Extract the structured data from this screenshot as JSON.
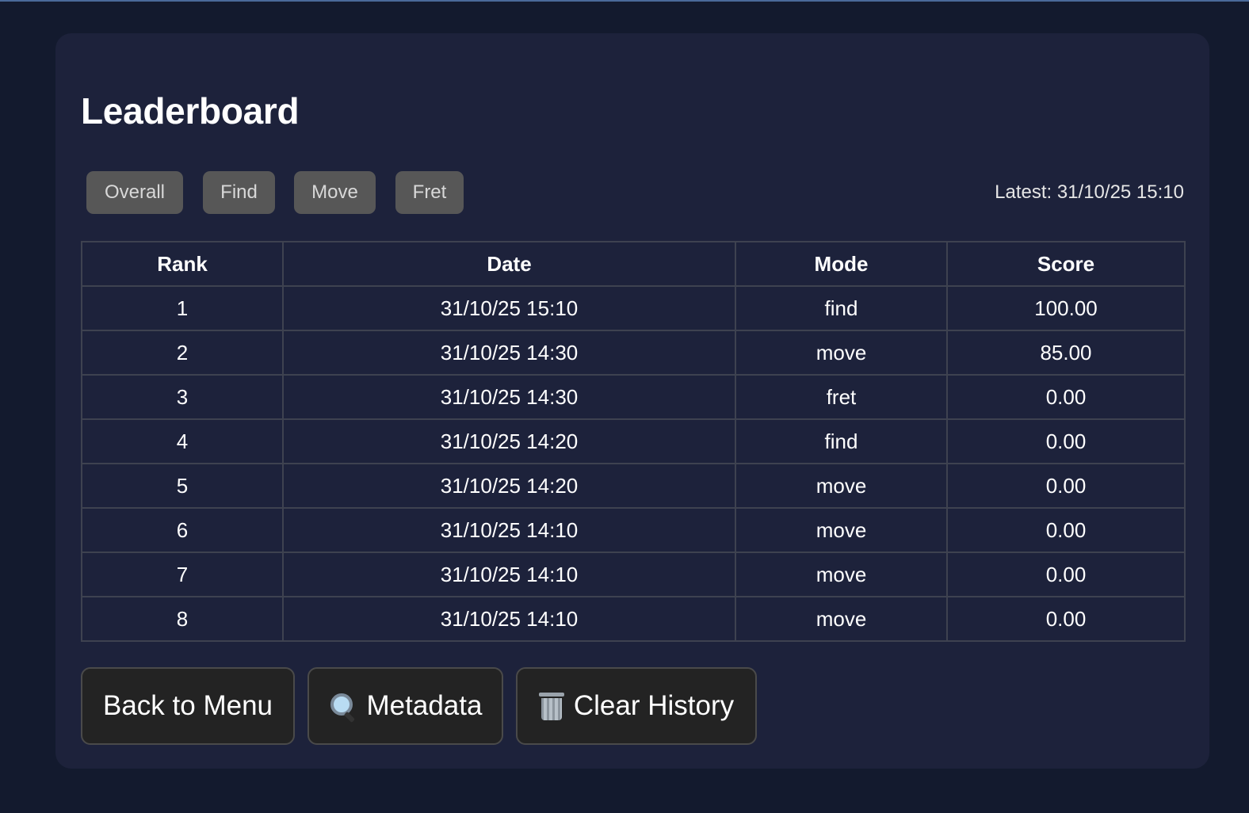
{
  "title": "Leaderboard",
  "filters": {
    "items": [
      {
        "label": "Overall"
      },
      {
        "label": "Find"
      },
      {
        "label": "Move"
      },
      {
        "label": "Fret"
      }
    ],
    "latest": "Latest: 31/10/25 15:10"
  },
  "table": {
    "columns": [
      "Rank",
      "Date",
      "Mode",
      "Score"
    ],
    "rows": [
      [
        "1",
        "31/10/25 15:10",
        "find",
        "100.00"
      ],
      [
        "2",
        "31/10/25 14:30",
        "move",
        "85.00"
      ],
      [
        "3",
        "31/10/25 14:30",
        "fret",
        "0.00"
      ],
      [
        "4",
        "31/10/25 14:20",
        "find",
        "0.00"
      ],
      [
        "5",
        "31/10/25 14:20",
        "move",
        "0.00"
      ],
      [
        "6",
        "31/10/25 14:10",
        "move",
        "0.00"
      ],
      [
        "7",
        "31/10/25 14:10",
        "move",
        "0.00"
      ],
      [
        "8",
        "31/10/25 14:10",
        "move",
        "0.00"
      ]
    ]
  },
  "actions": {
    "back_label": "Back to Menu",
    "metadata_label": "Metadata",
    "metadata_icon": "magnifying-glass-icon",
    "clear_label": "Clear History",
    "clear_icon": "wastebasket-icon"
  },
  "colors": {
    "page_background": "#131a2e",
    "panel_background": "#1d223b",
    "filter_button": "#575757",
    "action_button": "#232323"
  }
}
